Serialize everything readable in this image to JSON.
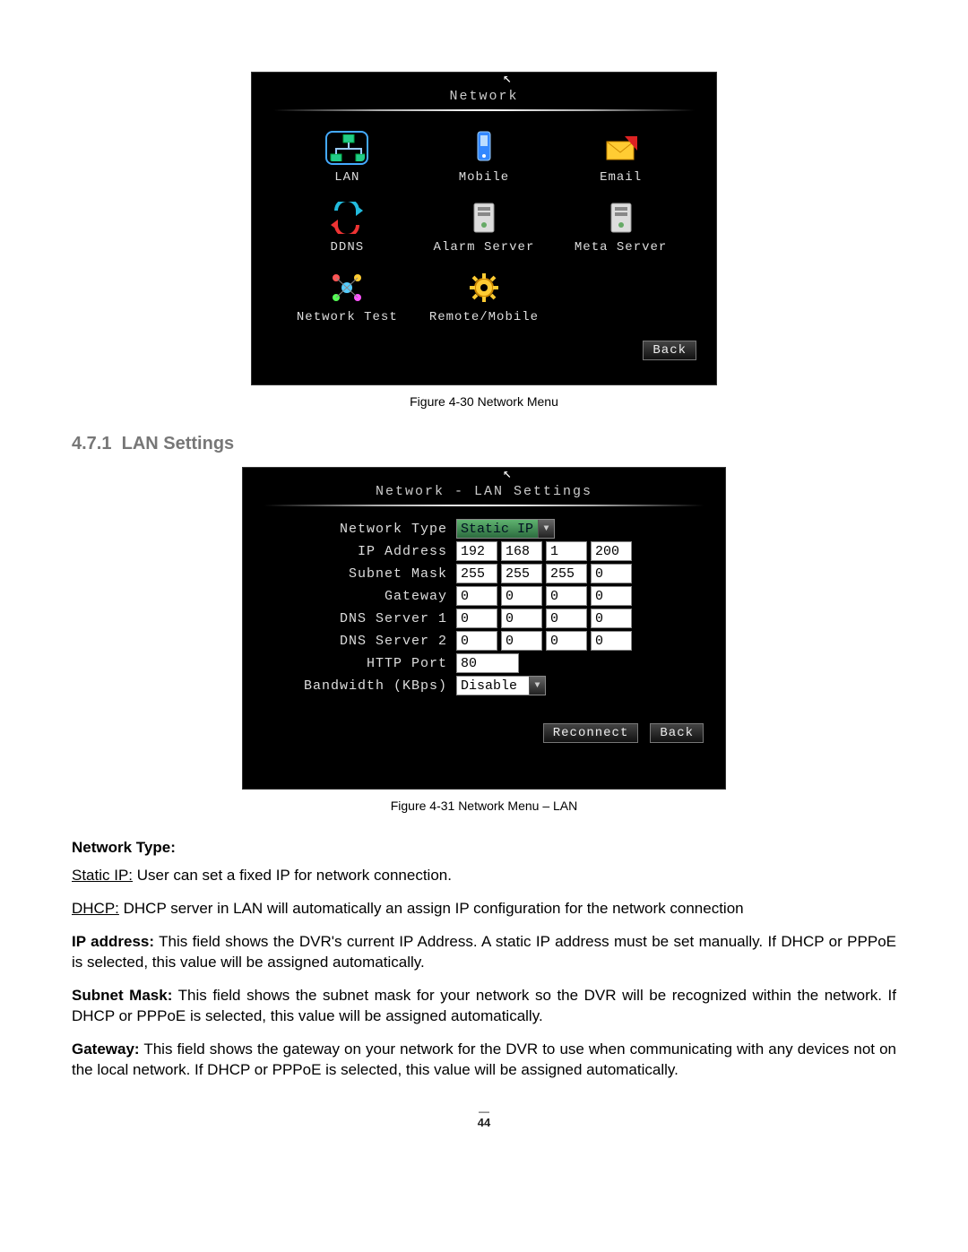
{
  "fig1": {
    "cursor_glyph": "▲",
    "title": "Network",
    "items": [
      {
        "label": "LAN"
      },
      {
        "label": "Mobile"
      },
      {
        "label": "Email"
      },
      {
        "label": "DDNS"
      },
      {
        "label": "Alarm Server"
      },
      {
        "label": "Meta Server"
      },
      {
        "label": "Network Test"
      },
      {
        "label": "Remote/Mobile"
      }
    ],
    "back": "Back",
    "caption": "Figure 4-30 Network Menu"
  },
  "section": {
    "number": "4.7.1",
    "title": "LAN Settings"
  },
  "fig2": {
    "cursor_glyph": "▲",
    "title": "Network - LAN Settings",
    "rows": {
      "network_type": {
        "label": "Network Type",
        "value": "Static IP"
      },
      "ip_address": {
        "label": "IP Address",
        "octets": [
          "192",
          "168",
          "1",
          "200"
        ]
      },
      "subnet_mask": {
        "label": "Subnet Mask",
        "octets": [
          "255",
          "255",
          "255",
          "0"
        ]
      },
      "gateway": {
        "label": "Gateway",
        "octets": [
          "0",
          "0",
          "0",
          "0"
        ]
      },
      "dns1": {
        "label": "DNS Server 1",
        "octets": [
          "0",
          "0",
          "0",
          "0"
        ]
      },
      "dns2": {
        "label": "DNS Server 2",
        "octets": [
          "0",
          "0",
          "0",
          "0"
        ]
      },
      "http_port": {
        "label": "HTTP Port",
        "value": "80"
      },
      "bandwidth": {
        "label": "Bandwidth (KBps)",
        "value": "Disable"
      }
    },
    "reconnect": "Reconnect",
    "back": "Back",
    "caption": "Figure 4-31 Network Menu – LAN"
  },
  "text": {
    "nt_heading": "Network Type:",
    "static_label": "Static IP:",
    "static_desc": " User can set a fixed IP for network connection.",
    "dhcp_label": "DHCP:",
    "dhcp_desc": " DHCP server in LAN will automatically an assign IP configuration for the network connection",
    "ip_label": "IP address:",
    "ip_desc": " This field shows the DVR's current IP Address. A static IP address must be set manually. If DHCP or PPPoE is selected, this value will be assigned automatically.",
    "sm_label": "Subnet Mask:",
    "sm_desc": " This field shows the subnet mask for your network so the DVR will be recognized within the network. If DHCP or PPPoE is selected, this value will be assigned automatically.",
    "gw_label": "Gateway:",
    "gw_desc": " This field shows the gateway on your network for the DVR to use when communicating with any devices not on the local network. If DHCP or PPPoE is selected, this value will be assigned automatically.",
    "page_no": "44"
  }
}
